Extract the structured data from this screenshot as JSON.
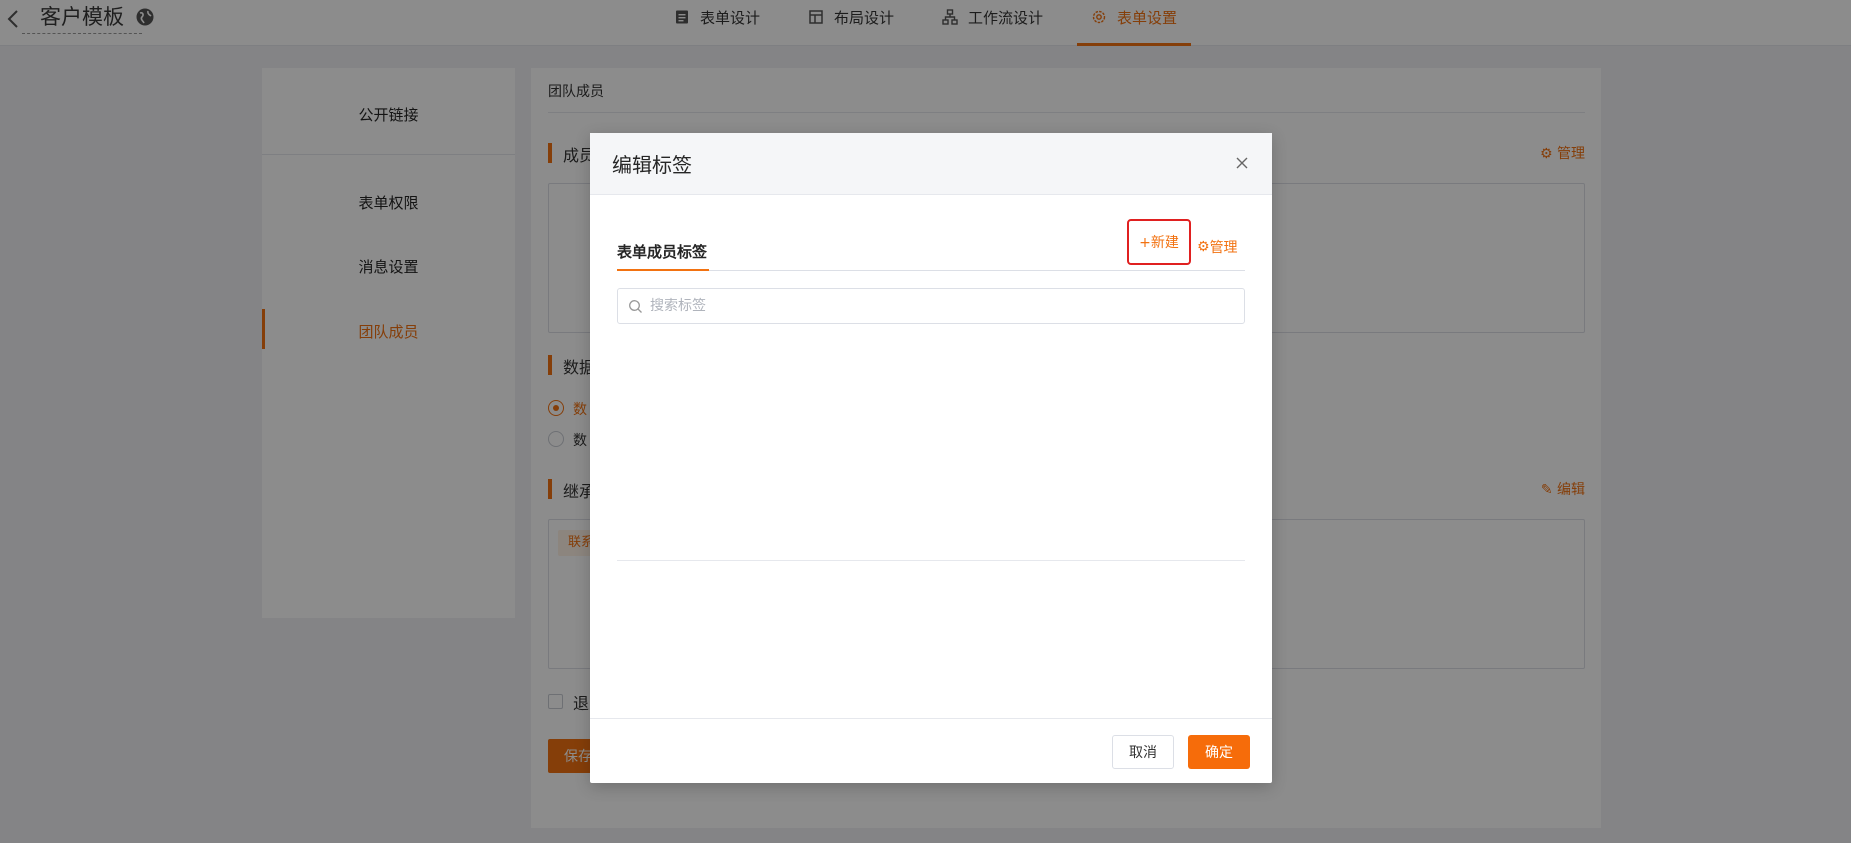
{
  "header": {
    "back_icon": "chevron-left-icon",
    "title": "客户模板",
    "globe_icon": "globe-icon",
    "tabs": [
      {
        "label": "表单设计",
        "icon": "form-icon"
      },
      {
        "label": "布局设计",
        "icon": "layout-icon"
      },
      {
        "label": "工作流设计",
        "icon": "workflow-icon"
      },
      {
        "label": "表单设置",
        "icon": "gear-icon",
        "active": true
      }
    ]
  },
  "sidebar": {
    "items": [
      {
        "label": "公开链接"
      },
      {
        "label": "表单权限"
      },
      {
        "label": "消息设置"
      },
      {
        "label": "团队成员",
        "active": true
      }
    ]
  },
  "main": {
    "title": "团队成员",
    "sections": [
      {
        "label": "成员",
        "action": "管理",
        "action_icon": "gear-icon"
      },
      {
        "label": "数据"
      },
      {
        "label": "继承",
        "action": "编辑",
        "action_icon": "edit-icon"
      }
    ],
    "radios": [
      {
        "label": "数",
        "checked": true
      },
      {
        "label": "数",
        "checked": false
      }
    ],
    "chip": "联系",
    "checkbox_label": "退",
    "save_label": "保存"
  },
  "modal": {
    "title": "编辑标签",
    "tab": "表单成员标签",
    "new_label": "+新建",
    "manage_label": "管理",
    "search_placeholder": "搜索标签",
    "cancel_label": "取消",
    "ok_label": "确定"
  },
  "colors": {
    "accent": "#f27211",
    "highlight_border": "#e02020",
    "overlay": "rgba(0,0,0,0.45)"
  }
}
